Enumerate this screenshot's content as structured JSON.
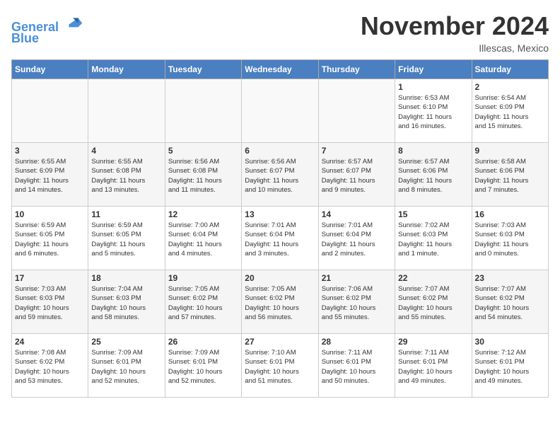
{
  "header": {
    "logo_line1": "General",
    "logo_line2": "Blue",
    "month_title": "November 2024",
    "location": "Illescas, Mexico"
  },
  "days_of_week": [
    "Sunday",
    "Monday",
    "Tuesday",
    "Wednesday",
    "Thursday",
    "Friday",
    "Saturday"
  ],
  "weeks": [
    [
      {
        "day": "",
        "info": ""
      },
      {
        "day": "",
        "info": ""
      },
      {
        "day": "",
        "info": ""
      },
      {
        "day": "",
        "info": ""
      },
      {
        "day": "",
        "info": ""
      },
      {
        "day": "1",
        "info": "Sunrise: 6:53 AM\nSunset: 6:10 PM\nDaylight: 11 hours\nand 16 minutes."
      },
      {
        "day": "2",
        "info": "Sunrise: 6:54 AM\nSunset: 6:09 PM\nDaylight: 11 hours\nand 15 minutes."
      }
    ],
    [
      {
        "day": "3",
        "info": "Sunrise: 6:55 AM\nSunset: 6:09 PM\nDaylight: 11 hours\nand 14 minutes."
      },
      {
        "day": "4",
        "info": "Sunrise: 6:55 AM\nSunset: 6:08 PM\nDaylight: 11 hours\nand 13 minutes."
      },
      {
        "day": "5",
        "info": "Sunrise: 6:56 AM\nSunset: 6:08 PM\nDaylight: 11 hours\nand 11 minutes."
      },
      {
        "day": "6",
        "info": "Sunrise: 6:56 AM\nSunset: 6:07 PM\nDaylight: 11 hours\nand 10 minutes."
      },
      {
        "day": "7",
        "info": "Sunrise: 6:57 AM\nSunset: 6:07 PM\nDaylight: 11 hours\nand 9 minutes."
      },
      {
        "day": "8",
        "info": "Sunrise: 6:57 AM\nSunset: 6:06 PM\nDaylight: 11 hours\nand 8 minutes."
      },
      {
        "day": "9",
        "info": "Sunrise: 6:58 AM\nSunset: 6:06 PM\nDaylight: 11 hours\nand 7 minutes."
      }
    ],
    [
      {
        "day": "10",
        "info": "Sunrise: 6:59 AM\nSunset: 6:05 PM\nDaylight: 11 hours\nand 6 minutes."
      },
      {
        "day": "11",
        "info": "Sunrise: 6:59 AM\nSunset: 6:05 PM\nDaylight: 11 hours\nand 5 minutes."
      },
      {
        "day": "12",
        "info": "Sunrise: 7:00 AM\nSunset: 6:04 PM\nDaylight: 11 hours\nand 4 minutes."
      },
      {
        "day": "13",
        "info": "Sunrise: 7:01 AM\nSunset: 6:04 PM\nDaylight: 11 hours\nand 3 minutes."
      },
      {
        "day": "14",
        "info": "Sunrise: 7:01 AM\nSunset: 6:04 PM\nDaylight: 11 hours\nand 2 minutes."
      },
      {
        "day": "15",
        "info": "Sunrise: 7:02 AM\nSunset: 6:03 PM\nDaylight: 11 hours\nand 1 minute."
      },
      {
        "day": "16",
        "info": "Sunrise: 7:03 AM\nSunset: 6:03 PM\nDaylight: 11 hours\nand 0 minutes."
      }
    ],
    [
      {
        "day": "17",
        "info": "Sunrise: 7:03 AM\nSunset: 6:03 PM\nDaylight: 10 hours\nand 59 minutes."
      },
      {
        "day": "18",
        "info": "Sunrise: 7:04 AM\nSunset: 6:03 PM\nDaylight: 10 hours\nand 58 minutes."
      },
      {
        "day": "19",
        "info": "Sunrise: 7:05 AM\nSunset: 6:02 PM\nDaylight: 10 hours\nand 57 minutes."
      },
      {
        "day": "20",
        "info": "Sunrise: 7:05 AM\nSunset: 6:02 PM\nDaylight: 10 hours\nand 56 minutes."
      },
      {
        "day": "21",
        "info": "Sunrise: 7:06 AM\nSunset: 6:02 PM\nDaylight: 10 hours\nand 55 minutes."
      },
      {
        "day": "22",
        "info": "Sunrise: 7:07 AM\nSunset: 6:02 PM\nDaylight: 10 hours\nand 55 minutes."
      },
      {
        "day": "23",
        "info": "Sunrise: 7:07 AM\nSunset: 6:02 PM\nDaylight: 10 hours\nand 54 minutes."
      }
    ],
    [
      {
        "day": "24",
        "info": "Sunrise: 7:08 AM\nSunset: 6:02 PM\nDaylight: 10 hours\nand 53 minutes."
      },
      {
        "day": "25",
        "info": "Sunrise: 7:09 AM\nSunset: 6:01 PM\nDaylight: 10 hours\nand 52 minutes."
      },
      {
        "day": "26",
        "info": "Sunrise: 7:09 AM\nSunset: 6:01 PM\nDaylight: 10 hours\nand 52 minutes."
      },
      {
        "day": "27",
        "info": "Sunrise: 7:10 AM\nSunset: 6:01 PM\nDaylight: 10 hours\nand 51 minutes."
      },
      {
        "day": "28",
        "info": "Sunrise: 7:11 AM\nSunset: 6:01 PM\nDaylight: 10 hours\nand 50 minutes."
      },
      {
        "day": "29",
        "info": "Sunrise: 7:11 AM\nSunset: 6:01 PM\nDaylight: 10 hours\nand 49 minutes."
      },
      {
        "day": "30",
        "info": "Sunrise: 7:12 AM\nSunset: 6:01 PM\nDaylight: 10 hours\nand 49 minutes."
      }
    ]
  ]
}
